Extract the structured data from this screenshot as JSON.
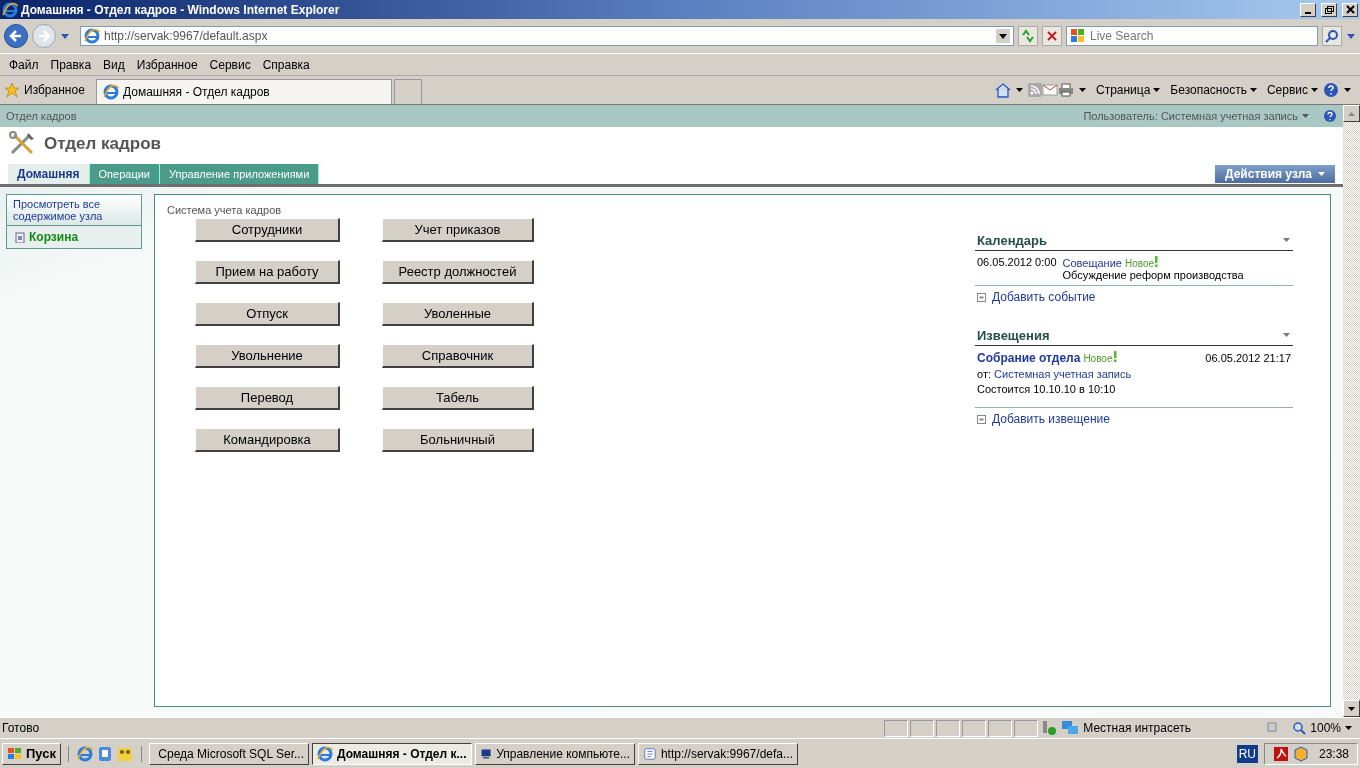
{
  "window": {
    "title": "Домашняя - Отдел кадров - Windows Internet Explorer"
  },
  "browser": {
    "address": "http://servak:9967/default.aspx",
    "search_placeholder": "Live Search",
    "menu": [
      "Файл",
      "Правка",
      "Вид",
      "Избранное",
      "Сервис",
      "Справка"
    ],
    "favorites": "Избранное",
    "tab_title": "Домашняя - Отдел кадров",
    "commands": [
      "Страница",
      "Безопасность",
      "Сервис"
    ]
  },
  "page": {
    "breadcrumb": "Отдел кадров",
    "user": "Пользователь: Системная учетная запись",
    "site_title": "Отдел кадров",
    "tabs": [
      {
        "label": "Домашняя",
        "selected": true
      },
      {
        "label": "Операции",
        "selected": false
      },
      {
        "label": "Управление приложениями",
        "selected": false
      }
    ],
    "site_actions": "Действия узла",
    "quick_launch": [
      {
        "label": "Просмотреть все содержимое узла",
        "kind": "link"
      },
      {
        "label": "Корзина",
        "kind": "recycle"
      }
    ],
    "section_title": "Система учета кадров",
    "buttons": [
      "Сотрудники",
      "Учет приказов",
      "Прием на работу",
      "Реестр должностей",
      "Отпуск",
      "Уволенные",
      "Увольнение",
      "Справочник",
      "Перевод",
      "Табель",
      "Командировка",
      "Больничный"
    ],
    "calendar": {
      "title": "Календарь",
      "events": [
        {
          "date": "06.05.2012 0:00",
          "title": "Совещание",
          "badge": "Новое",
          "description": "Обсуждение реформ производства"
        }
      ],
      "add_link": "Добавить событие"
    },
    "announcements": {
      "title": "Извещения",
      "items": [
        {
          "title": "Собрание отдела",
          "badge": "Новое",
          "date": "06.05.2012 21:17",
          "from_label": "от:",
          "author": "Системная учетная запись",
          "body": "Состоится 10.10.10 в 10:10"
        }
      ],
      "add_link": "Добавить извещение"
    }
  },
  "status_bar": {
    "text": "Готово",
    "zone": "Местная интрасеть",
    "zoom": "100%"
  },
  "taskbar": {
    "start": "Пуск",
    "tasks": [
      {
        "label": "Среда Microsoft SQL Ser...",
        "selected": false
      },
      {
        "label": "Домашняя - Отдел к...",
        "selected": true
      },
      {
        "label": "Управление компьюте...",
        "selected": false
      },
      {
        "label": "http://servak:9967/defa...",
        "selected": false
      }
    ],
    "language": "RU",
    "clock": "23:38"
  }
}
